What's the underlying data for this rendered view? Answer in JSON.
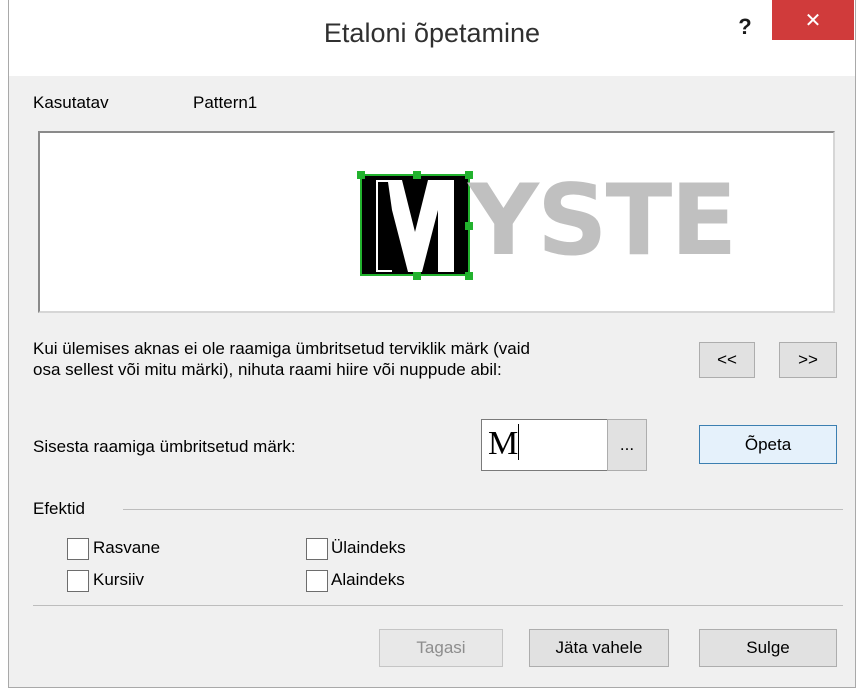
{
  "window": {
    "title": "Etaloni õpetamine",
    "help_label": "?",
    "close_label": "✕"
  },
  "header": {
    "user_label": "Kasutatav",
    "pattern_name": "Pattern1"
  },
  "preview": {
    "selected_char": "M",
    "remaining_text": "YSTE",
    "frame_color": "#22b22e",
    "selected_fill": "#000000",
    "text_color": "#c0c0c0"
  },
  "instructions": {
    "line1": "Kui ülemises aknas ei ole raamiga ümbritsetud terviklik märk (vaid",
    "line2": "osa sellest või mitu märki), nihuta raami hiire või nuppude abil:"
  },
  "nav": {
    "prev_label": "<<",
    "next_label": ">>"
  },
  "entry": {
    "label": "Sisesta raamiga ümbritsetud märk:",
    "value": "M",
    "browse_label": "...",
    "train_label": "Õpeta"
  },
  "effects": {
    "group_label": "Efektid",
    "options": [
      {
        "label": "Rasvane",
        "checked": false
      },
      {
        "label": "Kursiiv",
        "checked": false
      },
      {
        "label": "Ülaindeks",
        "checked": false
      },
      {
        "label": "Alaindeks",
        "checked": false
      }
    ]
  },
  "footer": {
    "back_label": "Tagasi",
    "skip_label": "Jäta vahele",
    "close_label": "Sulge"
  }
}
